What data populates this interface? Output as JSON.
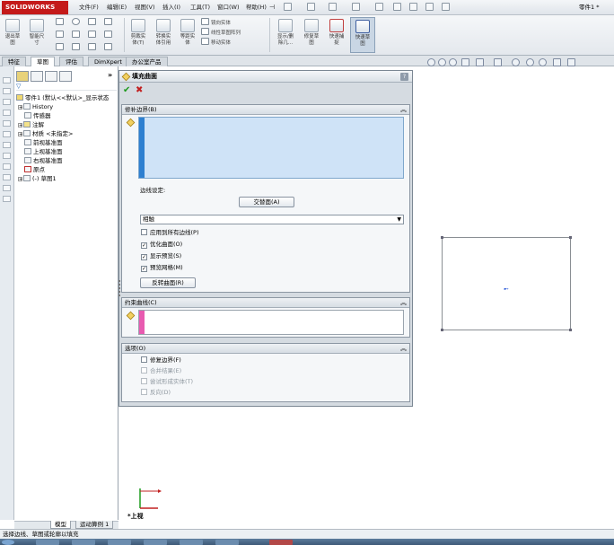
{
  "app": {
    "brand": "SOLIDWORKS",
    "document_name": "零件1 *"
  },
  "menu": [
    "文件(F)",
    "编辑(E)",
    "视图(V)",
    "插入(I)",
    "工具(T)",
    "窗口(W)",
    "帮助(H)"
  ],
  "ribbon": {
    "buttons": [
      {
        "label1": "退出草",
        "label2": "图",
        "icon": "exit-sketch-icon"
      },
      {
        "label1": "智能尺",
        "label2": "寸",
        "icon": "smart-dimension-icon"
      },
      {
        "label1": "剪裁实",
        "label2": "体(T)",
        "icon": "trim-entities-icon"
      },
      {
        "label1": "转换实",
        "label2": "体引用",
        "icon": "convert-entities-icon"
      },
      {
        "label1": "等距实",
        "label2": "体",
        "icon": "offset-entities-icon"
      },
      {
        "label1": "显示/删",
        "label2": "除几...",
        "icon": "display-delete-relations-icon"
      },
      {
        "label1": "修复草",
        "label2": "图",
        "icon": "repair-sketch-icon"
      },
      {
        "label1": "快速捕",
        "label2": "捉",
        "icon": "quick-snaps-icon"
      },
      {
        "label1": "快速草",
        "label2": "图",
        "icon": "rapid-sketch-icon"
      }
    ],
    "small_labels": [
      "镜向实体",
      "线性草图阵列",
      "移动实体"
    ]
  },
  "tabs": [
    "特征",
    "草图",
    "评估",
    "DimXpert",
    "办公室产品"
  ],
  "active_tab_index": 1,
  "feature_tree": {
    "root": "零件1 (默认<<默认>_显示状态",
    "items": [
      {
        "label": "History",
        "expandable": true
      },
      {
        "label": "传感器",
        "expandable": false
      },
      {
        "label": "注解",
        "expandable": true
      },
      {
        "label": "材质 <未指定>",
        "expandable": true
      },
      {
        "label": "前视基准面",
        "expandable": false
      },
      {
        "label": "上视基准面",
        "expandable": false
      },
      {
        "label": "右视基准面",
        "expandable": false
      },
      {
        "label": "原点",
        "expandable": false
      },
      {
        "label": "(-) 草图1",
        "expandable": true
      }
    ],
    "bottom_tabs": [
      "模型",
      "运动算例 1"
    ]
  },
  "property_manager": {
    "title": "填充曲面",
    "help_label": "?",
    "ok_label": "✔",
    "cancel_label": "✖",
    "patch_boundary": {
      "header": "修补边界(B)",
      "edge_settings_label": "边线设定:",
      "alternate_face_button": "交替面(A)",
      "contact_select_value": "相触",
      "options": [
        {
          "label": "应用到所有边线(P)",
          "checked": false
        },
        {
          "label": "优化曲面(O)",
          "checked": true
        },
        {
          "label": "显示预览(S)",
          "checked": true
        },
        {
          "label": "预览网格(M)",
          "checked": true
        }
      ],
      "reverse_surface_button": "反转曲面(R)"
    },
    "constraint_curves": {
      "header": "约束曲线(C)"
    },
    "options_group": {
      "header": "选项(O)",
      "items": [
        {
          "label": "修复边界(F)",
          "checked": false,
          "enabled": true
        },
        {
          "label": "合并结果(E)",
          "checked": false,
          "enabled": false
        },
        {
          "label": "尝试形成实体(T)",
          "checked": false,
          "enabled": false
        },
        {
          "label": "反向(D)",
          "checked": false,
          "enabled": false
        }
      ]
    }
  },
  "viewport": {
    "view_name": "*上视"
  },
  "status_bar": {
    "text": "选择边线、草图或轮廓以填充"
  },
  "colors": {
    "brand_red": "#c41a1a",
    "selection_blue": "#cfe3f7",
    "constraint_pink": "#e85bb0",
    "ok_green": "#1f9a1f",
    "cancel_red": "#c22020"
  }
}
